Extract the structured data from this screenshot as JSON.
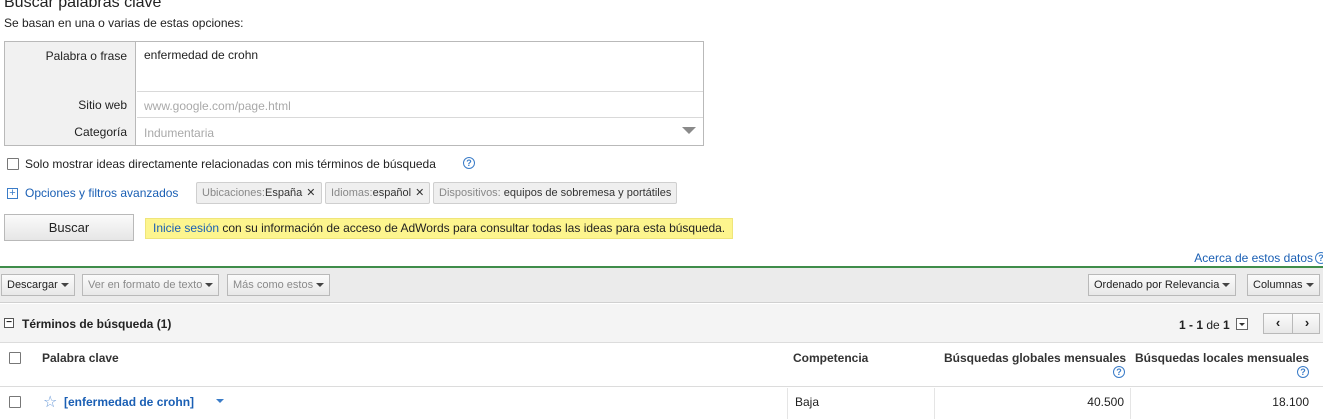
{
  "page": {
    "title": "Buscar palabras clave",
    "subtitle": "Se basan en una o varias de estas opciones:"
  },
  "form": {
    "keyword_label": "Palabra o frase",
    "keyword_value": "enfermedad de crohn",
    "website_label": "Sitio web",
    "website_placeholder": "www.google.com/page.html",
    "category_label": "Categoría",
    "category_placeholder": "Indumentaria"
  },
  "options": {
    "related_only_label": "Solo mostrar ideas directamente relacionadas con mis términos de búsqueda",
    "related_only_checked": false,
    "advanced_link": "Opciones y filtros avanzados"
  },
  "filters": [
    {
      "key": "Ubicaciones:",
      "value": "España",
      "removable": true
    },
    {
      "key": "Idiomas:",
      "value": "español",
      "removable": true
    },
    {
      "key": "Dispositivos:",
      "value": " equipos de sobremesa y portátiles",
      "removable": false
    }
  ],
  "search_button": "Buscar",
  "notice": {
    "link": "Inicie sesión",
    "text": " con su información de acceso de AdWords para consultar todas las ideas para esta búsqueda."
  },
  "about_link": "Acerca de estos datos",
  "toolbar": {
    "download": "Descargar",
    "text_format": "Ver en formato de texto",
    "more_like": "Más como estos",
    "sort": "Ordenado por Relevancia",
    "columns": "Columnas"
  },
  "results": {
    "section_title": "Términos de búsqueda (1)",
    "pager_range": "1 - 1",
    "pager_of": " de ",
    "pager_total": "1",
    "columns": {
      "keyword": "Palabra clave",
      "competition": "Competencia",
      "global": "Búsquedas globales mensuales",
      "local": "Búsquedas locales mensuales"
    },
    "rows": [
      {
        "keyword": "[enfermedad de crohn]",
        "competition": "Baja",
        "global": "40.500",
        "local": "18.100"
      }
    ]
  },
  "colors": {
    "link": "#1a5fb4",
    "accent_green": "#3f8d4a",
    "notice_bg": "#fdf58e"
  }
}
